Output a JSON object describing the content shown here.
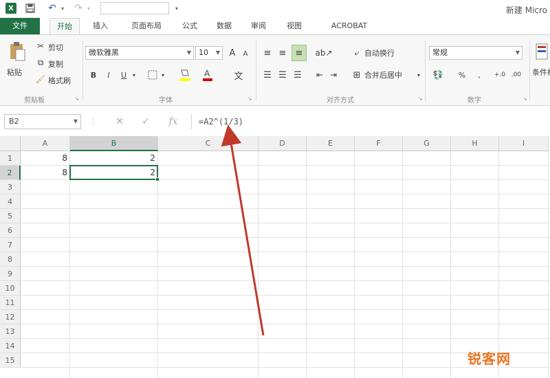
{
  "titlebar": {
    "app_icon": "X",
    "window_title": "新建 Micro"
  },
  "tabs": [
    {
      "label": "文件"
    },
    {
      "label": "开始"
    },
    {
      "label": "插入"
    },
    {
      "label": "页面布局"
    },
    {
      "label": "公式"
    },
    {
      "label": "数据"
    },
    {
      "label": "审阅"
    },
    {
      "label": "视图"
    },
    {
      "label": "ACROBAT"
    }
  ],
  "ribbon": {
    "clipboard": {
      "paste": "粘贴",
      "cut": "剪切",
      "copy": "复制",
      "format_painter": "格式刷",
      "group_label": "剪贴板"
    },
    "font": {
      "font_name": "微软雅黑",
      "font_size": "10",
      "grow": "A",
      "shrink": "A",
      "bold": "B",
      "italic": "I",
      "underline": "U",
      "font_color_glyph": "A",
      "text_effect_glyph": "文",
      "group_label": "字体"
    },
    "alignment": {
      "wrap_text": "自动换行",
      "merge_center": "合并后居中",
      "group_label": "对齐方式"
    },
    "number": {
      "format": "常规",
      "percent": "%",
      "comma": ",",
      "increase_decimal": "+.0",
      "decrease_decimal": ".00",
      "group_label": "数字"
    },
    "styles": {
      "conditional_format": "条件格"
    }
  },
  "formula_bar": {
    "name_box": "B2",
    "cancel": "✕",
    "enter": "✓",
    "fx": "fx",
    "formula": "=A2^(1/3)"
  },
  "grid": {
    "columns": [
      "A",
      "B",
      "C",
      "D",
      "E",
      "F",
      "G",
      "H",
      "I"
    ],
    "rows": [
      "1",
      "2",
      "3",
      "4",
      "5",
      "6",
      "7",
      "8",
      "9",
      "10",
      "11",
      "12",
      "13",
      "14",
      "15"
    ],
    "cells": {
      "A1": "8",
      "B1": "2",
      "A2": "8",
      "B2": "2"
    },
    "selected_cell": "B2"
  },
  "watermark": "锐客网",
  "colors": {
    "accent": "#217346",
    "annotation_arrow": "#c0392b",
    "watermark": "#e87722"
  }
}
